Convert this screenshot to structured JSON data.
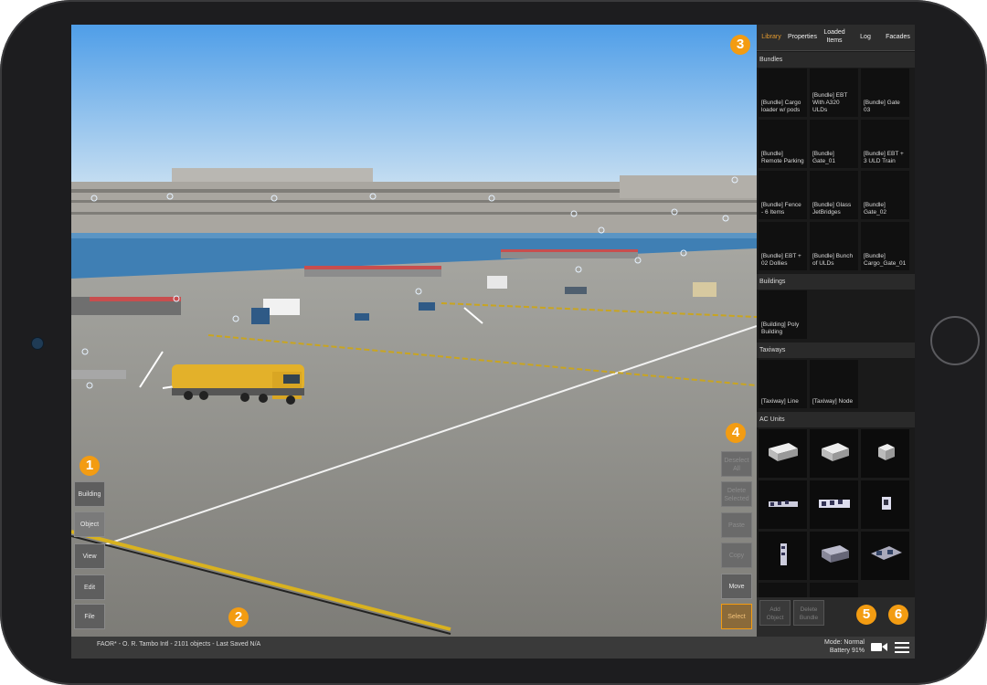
{
  "left_toolbar": {
    "building": "Building",
    "object": "Object",
    "view": "View",
    "edit": "Edit",
    "file": "File"
  },
  "right_toolbar": {
    "deselect": "Deselect All",
    "delete": "Delete Selected",
    "paste": "Paste",
    "copy": "Copy",
    "move": "Move",
    "select": "Select"
  },
  "badges": [
    "1",
    "2",
    "3",
    "4",
    "5",
    "6"
  ],
  "panel": {
    "tabs": [
      "Library",
      "Properties",
      "Loaded Items",
      "Log",
      "Facades"
    ],
    "active_tab": "Library",
    "sections": {
      "bundles": "Bundles",
      "buildings": "Buildings",
      "taxiways": "Taxiways",
      "ac_units": "AC Units"
    },
    "bundles": [
      "[Bundle] Cargo loader w/ pods",
      "[Bundle] EBT With A320 ULDs",
      "[Bundle] Gate 03",
      "[Bundle] Remote Parking",
      "[Bundle] Gate_01",
      "[Bundle] EBT + 3 ULD Train",
      "[Bundle] Fence - 6 Items",
      "[Bundle] Glass JetBridges",
      "[Bundle] Gate_02",
      "[Bundle] EBT + 02 Dollies",
      "[Bundle] Bunch of ULDs",
      "[Bundle] Cargo_Gate_01"
    ],
    "buildings": [
      "[Building] Poly Building"
    ],
    "taxiways": [
      "[Taxiway] Line",
      "[Taxiway] Node"
    ],
    "ac_units": [
      "ac-unit-icon",
      "ac-unit-icon",
      "ac-unit-icon",
      "ac-unit-icon",
      "ac-unit-icon",
      "ac-unit-icon",
      "ac-unit-icon",
      "ac-unit-icon",
      "ac-unit-icon"
    ],
    "add_object": "Add Object",
    "delete_bundle": "Delete Bundle"
  },
  "status": {
    "info": "FAOR* - O. R. Tambo Intl - 2101 objects - Last Saved N/A",
    "mode": "Mode: Normal",
    "battery": "Battery 91%"
  },
  "colors": {
    "accent": "#f39c12",
    "active_tab": "#e39a2f",
    "fuel_truck": "#e3b12a",
    "sky_top": "#5fa7e6",
    "tarmac": "#8f8e89"
  }
}
